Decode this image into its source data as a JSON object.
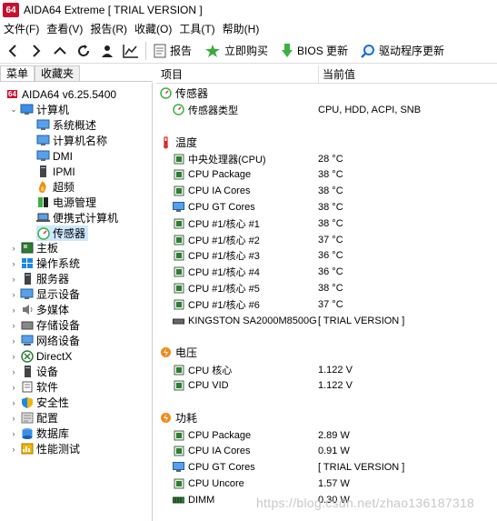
{
  "title": {
    "logo": "64",
    "text": "AIDA64 Extreme  [ TRIAL VERSION ]"
  },
  "menu": [
    "文件(F)",
    "查看(V)",
    "报告(R)",
    "收藏(O)",
    "工具(T)",
    "帮助(H)"
  ],
  "toolbar": {
    "report": "报告",
    "buy": "立即购买",
    "bios": "BIOS 更新",
    "driver": "驱动程序更新"
  },
  "tabs": {
    "menu": "菜单",
    "favorites": "收藏夹"
  },
  "tree": {
    "root": "AIDA64 v6.25.5400",
    "computer": "计算机",
    "computer_children": [
      "系统概述",
      "计算机名称",
      "DMI",
      "IPMI",
      "超频",
      "电源管理",
      "便携式计算机",
      "传感器"
    ],
    "others": [
      "主板",
      "操作系统",
      "服务器",
      "显示设备",
      "多媒体",
      "存储设备",
      "网络设备",
      "DirectX",
      "设备",
      "软件",
      "安全性",
      "配置",
      "数据库",
      "性能测试"
    ]
  },
  "columns": {
    "item": "项目",
    "value": "当前值"
  },
  "sensor": {
    "title": "传感器",
    "type_label": "传感器类型",
    "type_value": "CPU, HDD, ACPI, SNB"
  },
  "temperature": {
    "title": "温度",
    "rows": [
      {
        "label": "中央处理器(CPU)",
        "value": "28 °C"
      },
      {
        "label": "CPU Package",
        "value": "38 °C"
      },
      {
        "label": "CPU IA Cores",
        "value": "38 °C"
      },
      {
        "label": "CPU GT Cores",
        "value": "38 °C"
      },
      {
        "label": "CPU #1/核心 #1",
        "value": "38 °C"
      },
      {
        "label": "CPU #1/核心 #2",
        "value": "37 °C"
      },
      {
        "label": "CPU #1/核心 #3",
        "value": "36 °C"
      },
      {
        "label": "CPU #1/核心 #4",
        "value": "36 °C"
      },
      {
        "label": "CPU #1/核心 #5",
        "value": "38 °C"
      },
      {
        "label": "CPU #1/核心 #6",
        "value": "37 °C"
      },
      {
        "label": "KINGSTON SA2000M8500G",
        "value": "[ TRIAL VERSION ]"
      }
    ]
  },
  "voltage": {
    "title": "电压",
    "rows": [
      {
        "label": "CPU 核心",
        "value": "1.122 V"
      },
      {
        "label": "CPU VID",
        "value": "1.122 V"
      }
    ]
  },
  "power": {
    "title": "功耗",
    "rows": [
      {
        "label": "CPU Package",
        "value": "2.89 W"
      },
      {
        "label": "CPU IA Cores",
        "value": "0.91 W"
      },
      {
        "label": "CPU GT Cores",
        "value": "[ TRIAL VERSION ]"
      },
      {
        "label": "CPU Uncore",
        "value": "1.57 W"
      },
      {
        "label": "DIMM",
        "value": "0.30 W"
      }
    ]
  },
  "watermark": "https://blog.csdn.net/zhao136187318"
}
